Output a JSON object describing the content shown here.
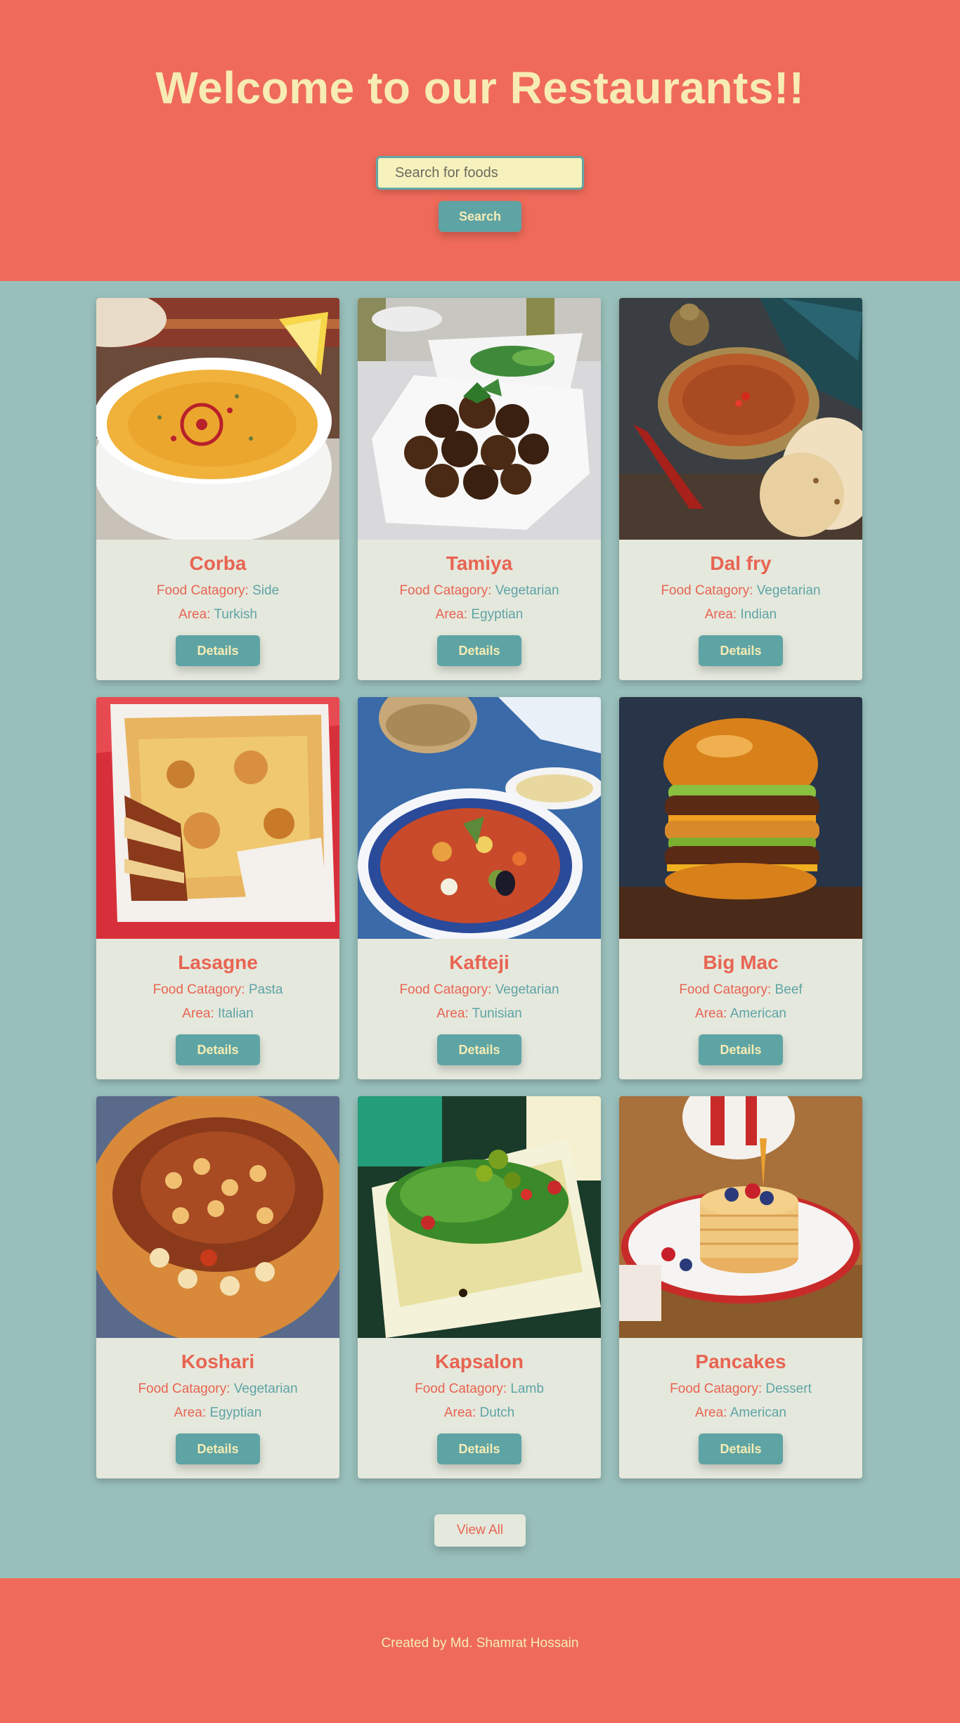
{
  "header": {
    "title": "Welcome to our Restaurants!!",
    "search_placeholder": "Search for foods",
    "search_button": "Search"
  },
  "labels": {
    "category": "Food Catagory:",
    "area": "Area:",
    "details": "Details"
  },
  "foods": [
    {
      "name": "Corba",
      "category": "Side",
      "area": "Turkish",
      "image": "soup-bowl-image"
    },
    {
      "name": "Tamiya",
      "category": "Vegetarian",
      "area": "Egyptian",
      "image": "falafel-plate-image"
    },
    {
      "name": "Dal fry",
      "category": "Vegetarian",
      "area": "Indian",
      "image": "dal-bowl-image"
    },
    {
      "name": "Lasagne",
      "category": "Pasta",
      "area": "Italian",
      "image": "lasagne-dish-image"
    },
    {
      "name": "Kafteji",
      "category": "Vegetarian",
      "area": "Tunisian",
      "image": "kafteji-plate-image"
    },
    {
      "name": "Big Mac",
      "category": "Beef",
      "area": "American",
      "image": "burger-image"
    },
    {
      "name": "Koshari",
      "category": "Vegetarian",
      "area": "Egyptian",
      "image": "koshari-plate-image"
    },
    {
      "name": "Kapsalon",
      "category": "Lamb",
      "area": "Dutch",
      "image": "kapsalon-plate-image"
    },
    {
      "name": "Pancakes",
      "category": "Dessert",
      "area": "American",
      "image": "pancakes-image"
    }
  ],
  "view_all": "View All",
  "footer": {
    "credit": "Created by Md. Shamrat Hossain"
  },
  "colors": {
    "header_bg": "#ef6a5a",
    "page_bg": "#99bfbb",
    "accent": "#5ea4a5",
    "cream": "#f7ecb4",
    "card_bg": "#e5e8dd"
  }
}
